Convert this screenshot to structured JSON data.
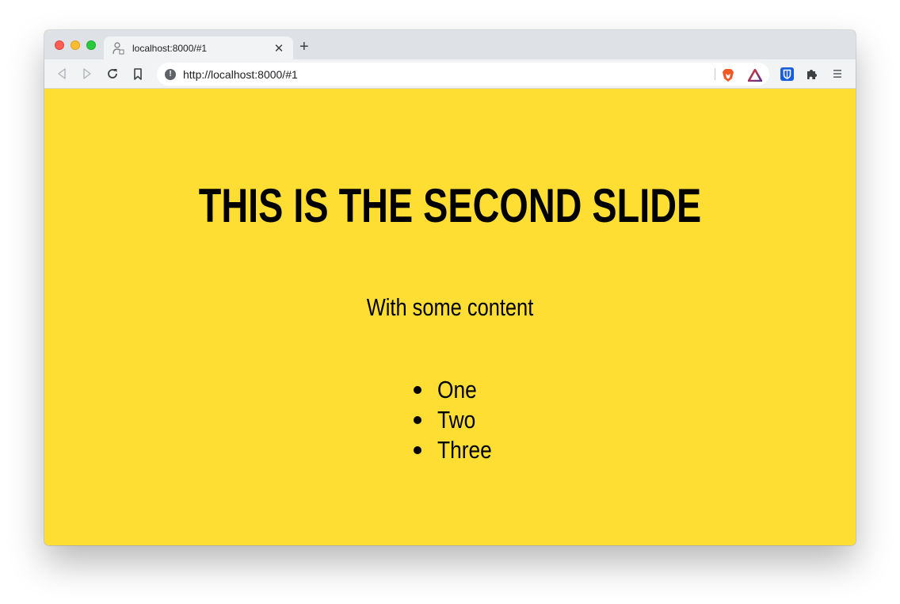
{
  "browser": {
    "tab": {
      "title": "localhost:8000/#1",
      "favicon": "user-agent-icon",
      "close_glyph": "✕"
    },
    "new_tab_glyph": "+",
    "toolbar": {
      "back_icon": "back-icon",
      "forward_icon": "forward-icon",
      "reload_icon": "reload-icon",
      "bookmark_icon": "bookmark-icon"
    },
    "omnibox": {
      "security_icon": "info-icon",
      "security_glyph": "!",
      "url": "http://localhost:8000/#1"
    },
    "extensions": [
      "brave-shields-icon",
      "brave-rewards-icon",
      "bitwarden-icon",
      "extensions-puzzle-icon",
      "menu-icon"
    ]
  },
  "slide": {
    "background": "#fede32",
    "title": "THIS IS THE SECOND SLIDE",
    "subtitle": "With some content",
    "list": [
      "One",
      "Two",
      "Three"
    ]
  }
}
